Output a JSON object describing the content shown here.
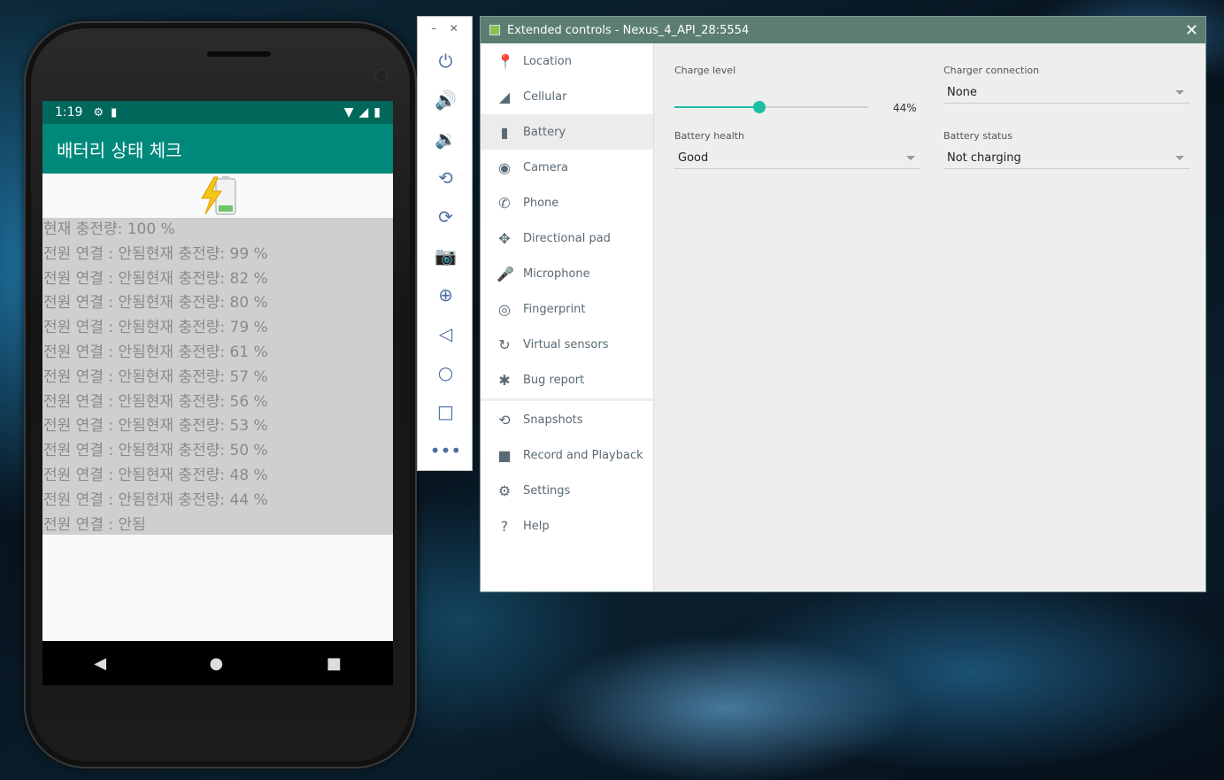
{
  "phone": {
    "status": {
      "time": "1:19"
    },
    "app_title": "배터리 상태 체크",
    "log_lines": [
      "현재 충전량: 100 %",
      "전원 연결 : 안됨현재 충전량: 99 %",
      "전원 연결 : 안됨현재 충전량: 82 %",
      "전원 연결 : 안됨현재 충전량: 80 %",
      "전원 연결 : 안됨현재 충전량: 79 %",
      "전원 연결 : 안됨현재 충전량: 61 %",
      "전원 연결 : 안됨현재 충전량: 57 %",
      "전원 연결 : 안됨현재 충전량: 56 %",
      "전원 연결 : 안됨현재 충전량: 53 %",
      "전원 연결 : 안됨현재 충전량: 50 %",
      "전원 연결 : 안됨현재 충전량: 48 %",
      "전원 연결 : 안됨현재 충전량: 44 %",
      "전원 연결 : 안됨"
    ]
  },
  "toolbar": {
    "buttons": [
      "power-icon",
      "volume-up-icon",
      "volume-down-icon",
      "rotate-left-icon",
      "rotate-right-icon",
      "camera-icon",
      "zoom-icon",
      "back-icon",
      "home-icon",
      "overview-icon",
      "more-icon"
    ]
  },
  "ext": {
    "title": "Extended controls - Nexus_4_API_28:5554",
    "sidebar": [
      {
        "label": "Location",
        "icon": "location-pin-icon"
      },
      {
        "label": "Cellular",
        "icon": "cellular-icon"
      },
      {
        "label": "Battery",
        "icon": "battery-icon",
        "active": true
      },
      {
        "label": "Camera",
        "icon": "aperture-icon"
      },
      {
        "label": "Phone",
        "icon": "phone-icon"
      },
      {
        "label": "Directional pad",
        "icon": "dpad-icon"
      },
      {
        "label": "Microphone",
        "icon": "microphone-icon"
      },
      {
        "label": "Fingerprint",
        "icon": "fingerprint-icon"
      },
      {
        "label": "Virtual sensors",
        "icon": "virtual-sensors-icon"
      },
      {
        "label": "Bug report",
        "icon": "bug-icon"
      },
      {
        "label": "Snapshots",
        "icon": "history-icon"
      },
      {
        "label": "Record and Playback",
        "icon": "videocam-icon"
      },
      {
        "label": "Settings",
        "icon": "gear-icon"
      },
      {
        "label": "Help",
        "icon": "help-icon"
      }
    ],
    "battery": {
      "charge_level_label": "Charge level",
      "charge_level_value": 44,
      "charge_level_text": "44%",
      "charger_connection_label": "Charger connection",
      "charger_connection_value": "None",
      "battery_health_label": "Battery health",
      "battery_health_value": "Good",
      "battery_status_label": "Battery status",
      "battery_status_value": "Not charging"
    },
    "colors": {
      "accent": "#1ebea5",
      "titlebar": "#5b7d72",
      "app_bar": "#00897b",
      "status_bar": "#00695c"
    }
  }
}
